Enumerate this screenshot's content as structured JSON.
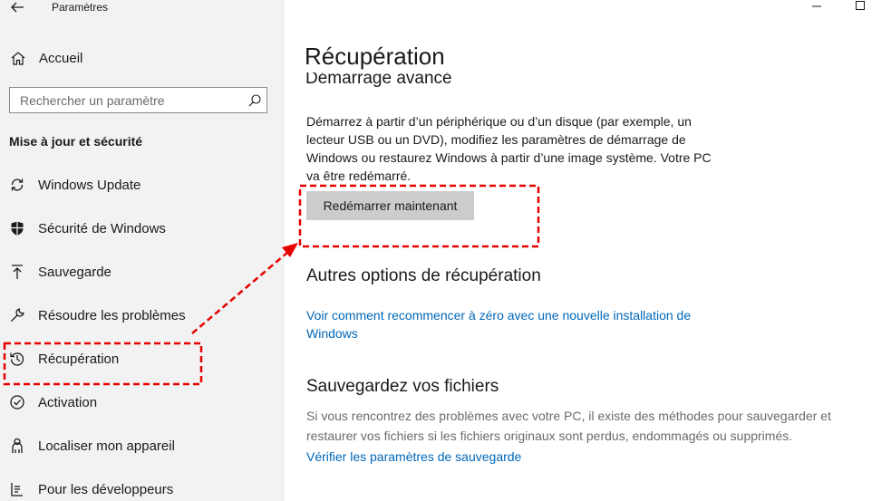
{
  "window": {
    "app_title": "Paramètres",
    "accent_color": "#0067b8",
    "annotation_color": "#e60000"
  },
  "sidebar": {
    "home_label": "Accueil",
    "search_placeholder": "Rechercher un paramètre",
    "section_heading": "Mise à jour et sécurité",
    "items": [
      {
        "label": "Windows Update",
        "icon": "sync-icon"
      },
      {
        "label": "Sécurité de Windows",
        "icon": "shield-icon"
      },
      {
        "label": "Sauvegarde",
        "icon": "upload-arrow-icon"
      },
      {
        "label": "Résoudre les problèmes",
        "icon": "wrench-icon"
      },
      {
        "label": "Récupération",
        "icon": "history-icon"
      },
      {
        "label": "Activation",
        "icon": "check-circle-icon"
      },
      {
        "label": "Localiser mon appareil",
        "icon": "person-icon"
      },
      {
        "label": "Pour les développeurs",
        "icon": "developer-icon"
      }
    ]
  },
  "main": {
    "page_title": "Récupération",
    "advanced_startup": {
      "heading": "Démarrage avancé",
      "description": "Démarrez à partir d’un périphérique ou d’un disque (par exemple, un lecteur USB ou un DVD), modifiez les paramètres de démarrage de Windows ou restaurez Windows à partir d’une image système. Votre PC va être redémarré.",
      "button_label": "Redémarrer maintenant"
    },
    "other_options": {
      "heading": "Autres options de récupération",
      "link": "Voir comment recommencer à zéro avec une nouvelle installation de Windows"
    },
    "backup": {
      "heading": "Sauvegardez vos fichiers",
      "description": "Si vous rencontrez des problèmes avec votre PC, il existe des méthodes pour sauvegarder et restaurer vos fichiers si les fichiers originaux sont perdus, endommagés ou supprimés.",
      "link": "Vérifier les paramètres de sauvegarde"
    }
  }
}
